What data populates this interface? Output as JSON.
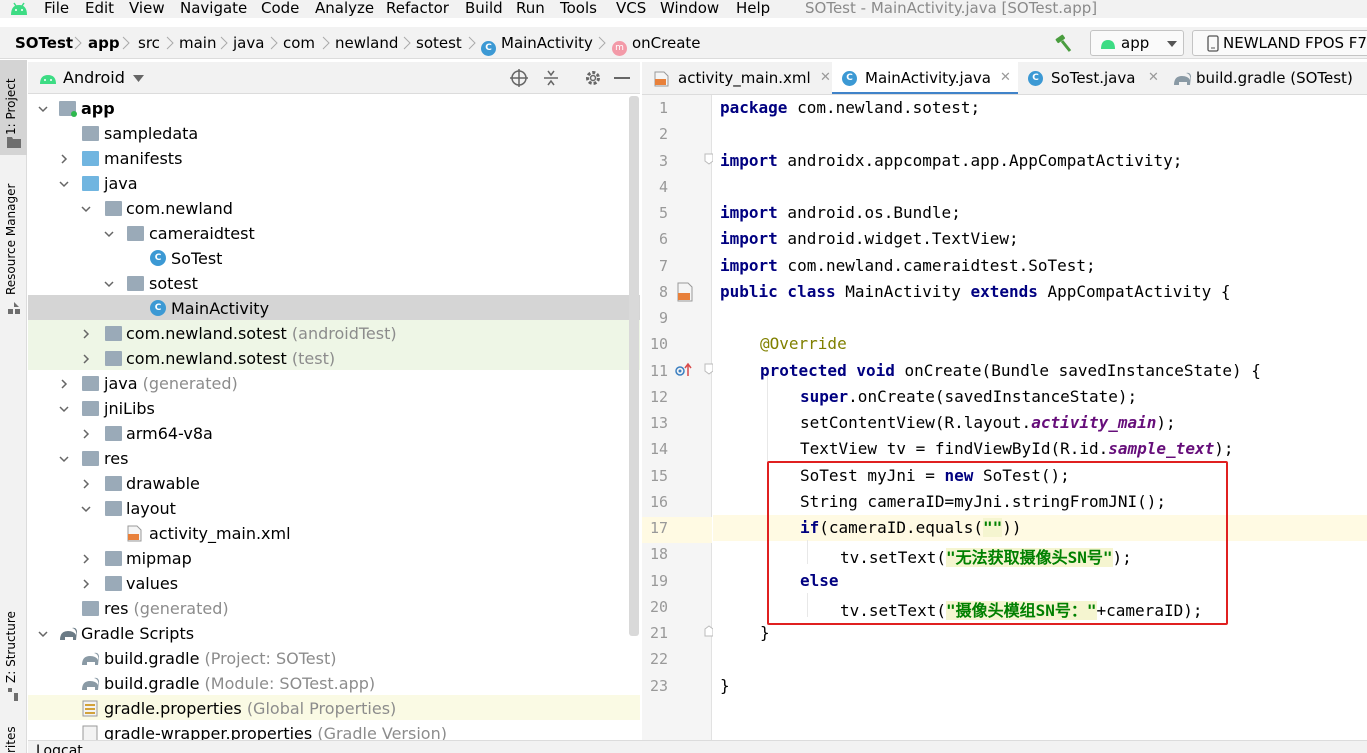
{
  "menubar": {
    "items": [
      "File",
      "Edit",
      "View",
      "Navigate",
      "Code",
      "Analyze",
      "Refactor",
      "Build",
      "Run",
      "Tools",
      "VCS",
      "Window",
      "Help"
    ],
    "window_title": "SOTest - MainActivity.java [SOTest.app]"
  },
  "navbar": {
    "breadcrumbs": [
      "SOTest",
      "app",
      "src",
      "main",
      "java",
      "com",
      "newland",
      "sotest",
      "MainActivity",
      "onCreate"
    ],
    "run_config": "app",
    "device": "NEWLAND FPOS F7"
  },
  "left_stripe": {
    "project_label": "1: Project",
    "resource_label": "Resource Manager",
    "structure_label": "Z: Structure",
    "favorites_label": "rites"
  },
  "project_panel": {
    "view_mode": "Android",
    "tree": [
      {
        "label": "app",
        "extra": "",
        "icon": "app-module-icon"
      },
      {
        "label": "sampledata",
        "extra": "",
        "icon": "folder-icon"
      },
      {
        "label": "manifests",
        "extra": "",
        "icon": "folder-icon"
      },
      {
        "label": "java",
        "extra": "",
        "icon": "folder-icon"
      },
      {
        "label": "com.newland",
        "extra": "",
        "icon": "package-icon"
      },
      {
        "label": "cameraidtest",
        "extra": "",
        "icon": "package-icon"
      },
      {
        "label": "SoTest",
        "extra": "",
        "icon": "class-icon"
      },
      {
        "label": "sotest",
        "extra": "",
        "icon": "package-icon"
      },
      {
        "label": "MainActivity",
        "extra": "",
        "icon": "class-icon"
      },
      {
        "label": "com.newland.sotest",
        "extra": "(androidTest)",
        "icon": "package-icon"
      },
      {
        "label": "com.newland.sotest",
        "extra": "(test)",
        "icon": "package-icon"
      },
      {
        "label": "java",
        "extra": "(generated)",
        "icon": "generated-folder-icon"
      },
      {
        "label": "jniLibs",
        "extra": "",
        "icon": "folder-icon"
      },
      {
        "label": "arm64-v8a",
        "extra": "",
        "icon": "folder-icon"
      },
      {
        "label": "res",
        "extra": "",
        "icon": "folder-icon"
      },
      {
        "label": "drawable",
        "extra": "",
        "icon": "folder-icon"
      },
      {
        "label": "layout",
        "extra": "",
        "icon": "folder-icon"
      },
      {
        "label": "activity_main.xml",
        "extra": "",
        "icon": "xml-file-icon"
      },
      {
        "label": "mipmap",
        "extra": "",
        "icon": "folder-icon"
      },
      {
        "label": "values",
        "extra": "",
        "icon": "folder-icon"
      },
      {
        "label": "res",
        "extra": "(generated)",
        "icon": "folder-icon"
      },
      {
        "label": "Gradle Scripts",
        "extra": "",
        "icon": "gradle-icon"
      },
      {
        "label": "build.gradle",
        "extra": "(Project: SOTest)",
        "icon": "gradle-icon"
      },
      {
        "label": "build.gradle",
        "extra": "(Module: SOTest.app)",
        "icon": "gradle-icon"
      },
      {
        "label": "gradle.properties",
        "extra": "(Global Properties)",
        "icon": "properties-icon"
      },
      {
        "label": "gradle-wrapper.properties",
        "extra": "(Gradle Version)",
        "icon": "properties-icon"
      }
    ]
  },
  "editor": {
    "tabs": [
      {
        "label": "activity_main.xml",
        "active": false
      },
      {
        "label": "MainActivity.java",
        "active": true
      },
      {
        "label": "SoTest.java",
        "active": false
      },
      {
        "label": "build.gradle (SOTest)",
        "active": false
      }
    ],
    "line_numbers": [
      "1",
      "2",
      "3",
      "4",
      "5",
      "6",
      "7",
      "8",
      "9",
      "10",
      "11",
      "12",
      "13",
      "14",
      "15",
      "16",
      "17",
      "18",
      "19",
      "20",
      "21",
      "22",
      "23"
    ],
    "code": {
      "l1_kw": "package",
      "l1_rest": " com.newland.sotest;",
      "l3_kw": "import",
      "l3_rest": " androidx.appcompat.app.AppCompatActivity;",
      "l5_kw": "import",
      "l5_rest": " android.os.Bundle;",
      "l6_kw": "import",
      "l6_rest": " android.widget.TextView;",
      "l7_kw": "import",
      "l7_rest": " com.newland.cameraidtest.SoTest;",
      "l8_kw1": "public class",
      "l8_mid": " MainActivity ",
      "l8_kw2": "extends",
      "l8_rest": " AppCompatActivity {",
      "l10_ann": "@Override",
      "l11_kw": "protected void",
      "l11_rest": " onCreate(Bundle savedInstanceState) {",
      "l12_kw": "super",
      "l12_rest": ".onCreate(savedInstanceState);",
      "l13_pre": "setContentView(R.layout.",
      "l13_fld": "activity_main",
      "l13_post": ");",
      "l14_pre": "TextView tv = findViewById(R.id.",
      "l14_fld": "sample_text",
      "l14_post": ");",
      "l15_pre": "SoTest myJni = ",
      "l15_kw": "new",
      "l15_post": " SoTest();",
      "l16": "String cameraID=myJni.stringFromJNI();",
      "l17_kw": "if",
      "l17_pre": "(cameraID.equals(",
      "l17_str": "\"\"",
      "l17_post": "))",
      "l18_pre": "tv.setText(",
      "l18_str": "\"无法获取摄像头SN号\"",
      "l18_post": ");",
      "l19_kw": "else",
      "l20_pre": "tv.setText(",
      "l20_str": "\"摄像头模组SN号：\"",
      "l20_post": "+cameraID);",
      "l21": "}",
      "l23": "}"
    }
  },
  "bottom": {
    "logcat_label": "Logcat"
  },
  "colors": {
    "keyword": "#000080",
    "annotation": "#808000",
    "field": "#660e7a",
    "string": "#008000",
    "highlight_box": "#e02020",
    "active_tab_underline": "#4083c9"
  }
}
